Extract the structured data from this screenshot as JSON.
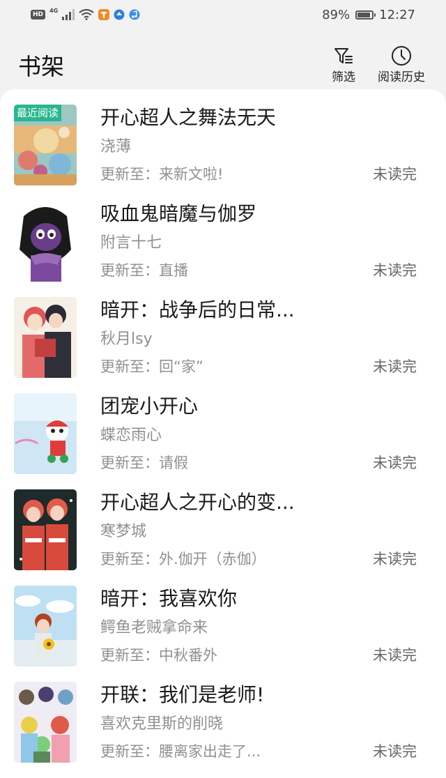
{
  "status_bar": {
    "hd": "HD",
    "network": "4G",
    "battery_text": "89%",
    "battery_level": 0.89,
    "time": "12:27",
    "icons": [
      "hd-icon",
      "signal-icon",
      "wifi-icon",
      "app-icon-orange",
      "app-icon-blue",
      "music-app-icon",
      "battery-icon"
    ]
  },
  "header": {
    "title": "书架",
    "filter_label": "筛选",
    "history_label": "阅读历史",
    "filter_icon": "filter-icon",
    "history_icon": "clock-icon"
  },
  "books": [
    {
      "title": "开心超人之舞法无天",
      "author": "浇薄",
      "update": "更新至：来新文啦!",
      "status": "未读完",
      "badge": "最近阅读"
    },
    {
      "title": "吸血鬼暗魔与伽罗",
      "author": "附言十七",
      "update": "更新至：直播",
      "status": "未读完"
    },
    {
      "title": "暗开：战争后的日常...",
      "author": "秋月lsy",
      "update": "更新至：回“家”",
      "status": "未读完"
    },
    {
      "title": "团宠小开心",
      "author": "蝶恋雨心",
      "update": "更新至：请假",
      "status": "未读完"
    },
    {
      "title": "开心超人之开心的变...",
      "author": "寒梦城",
      "update": "更新至：外.伽开（赤伽）",
      "status": "未读完"
    },
    {
      "title": "暗开：我喜欢你",
      "author": "鳄鱼老贼拿命来",
      "update": "更新至：中秋番外",
      "status": "未读完"
    },
    {
      "title": "开联：我们是老师!",
      "author": "喜欢克里斯的削晓",
      "update": "更新至：腰离家出走了...",
      "status": "未读完"
    }
  ],
  "colors": {
    "background": "#f2f2f2",
    "card": "#ffffff",
    "badge": "#1eb48c",
    "secondary_text": "#909090"
  }
}
